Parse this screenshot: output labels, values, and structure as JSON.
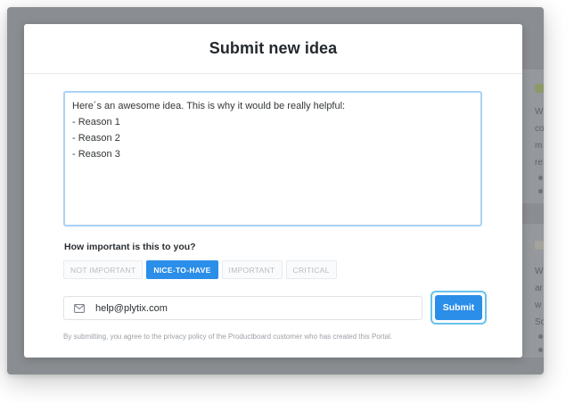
{
  "modal": {
    "title": "Submit new idea",
    "idea_text_lines": [
      "Here´s an awesome idea. This is why it would be really helpful:",
      "- Reason 1",
      "- Reason 2",
      "- Reason 3"
    ],
    "importance_question": "How important is this to you?",
    "importance_options": [
      {
        "label": "NOT IMPORTANT",
        "selected": false
      },
      {
        "label": "NICE-TO-HAVE",
        "selected": true
      },
      {
        "label": "IMPORTANT",
        "selected": false
      },
      {
        "label": "CRITICAL",
        "selected": false
      }
    ],
    "email_value": "help@plytix.com",
    "email_icon": "envelope-icon",
    "submit_label": "Submit",
    "legal_text": "By submitting, you agree to the privacy policy of the Productboard customer who has created this Portal."
  },
  "background": {
    "card1_letters": [
      "W",
      "co",
      "m",
      "re"
    ],
    "card2_letters": [
      "W",
      "ar",
      "w",
      "Sc"
    ]
  },
  "colors": {
    "accent": "#2b8ee8",
    "focus_ring": "#68c2ec",
    "textarea_border": "#a9d2f3"
  }
}
